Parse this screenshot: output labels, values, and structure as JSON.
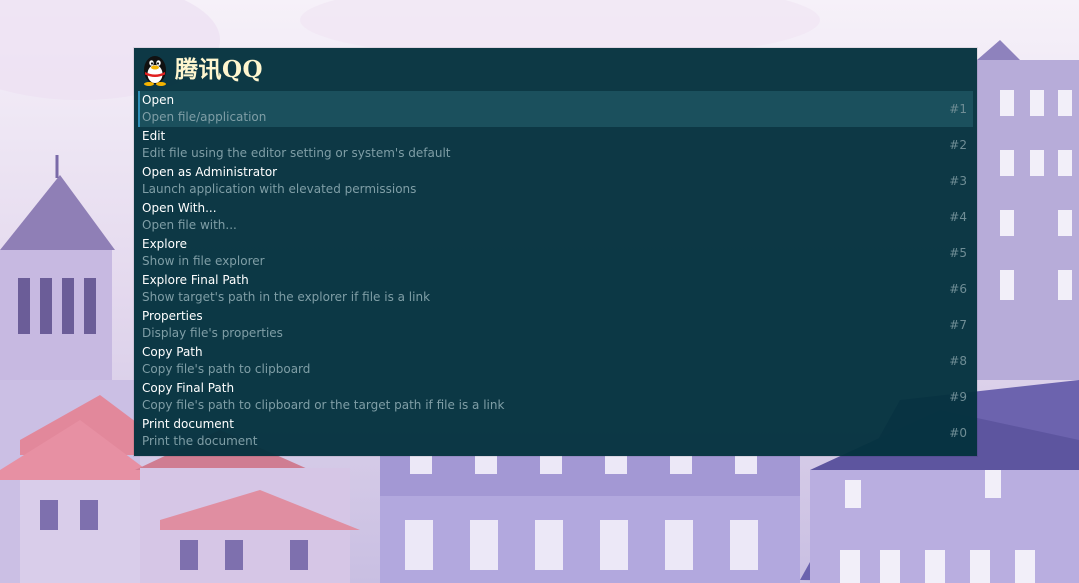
{
  "launcher": {
    "query": "腾讯QQ",
    "app_icon": "qq-penguin-icon",
    "results": [
      {
        "title": "Open",
        "subtitle": "Open file/application",
        "hotkey": "#1",
        "selected": true
      },
      {
        "title": "Edit",
        "subtitle": "Edit file using the editor setting or system's default",
        "hotkey": "#2"
      },
      {
        "title": "Open as Administrator",
        "subtitle": "Launch application with elevated permissions",
        "hotkey": "#3"
      },
      {
        "title": "Open With...",
        "subtitle": "Open file with...",
        "hotkey": "#4"
      },
      {
        "title": "Explore",
        "subtitle": "Show in file explorer",
        "hotkey": "#5"
      },
      {
        "title": "Explore Final Path",
        "subtitle": "Show target's path in the explorer if file is a link",
        "hotkey": "#6"
      },
      {
        "title": "Properties",
        "subtitle": "Display file's properties",
        "hotkey": "#7"
      },
      {
        "title": "Copy Path",
        "subtitle": "Copy file's path to clipboard",
        "hotkey": "#8"
      },
      {
        "title": "Copy Final Path",
        "subtitle": "Copy file's path to clipboard or the target path if file is a link",
        "hotkey": "#9"
      },
      {
        "title": "Print document",
        "subtitle": "Print the document",
        "hotkey": "#0"
      }
    ]
  },
  "colors": {
    "window_bg": "#04323e",
    "selected_bg": "#205866",
    "selected_accent": "#2f8fb8",
    "title_text": "#ffffff",
    "subtitle_text": "#7f9ea6",
    "query_text": "#fff6cf"
  },
  "wallpaper": "anime-style-town-buildings"
}
